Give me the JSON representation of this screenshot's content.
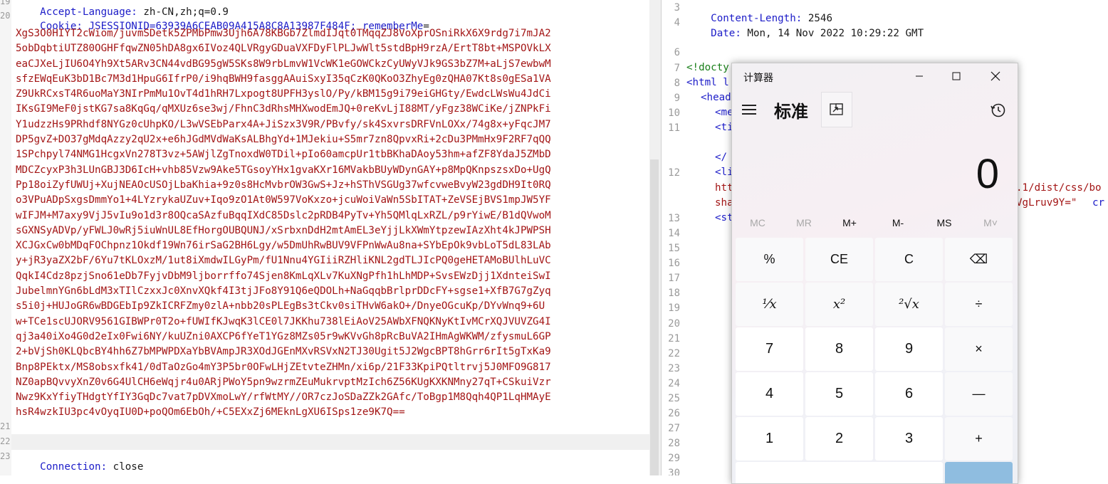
{
  "request_pane": {
    "lines": [
      {
        "n": "19",
        "key": "Accept-Language:",
        "value": " zh-CN,zh;q=0.9"
      },
      {
        "n": "20",
        "key": "Cookie:",
        "value": " JSESSIONID=63939A6CEAB09A415A8C8A13987F484F;",
        "key2": "rememberMe",
        "value2": "="
      }
    ],
    "cookie_value_lines": [
      "XgS3O0HIYT2cWiom/juvmSDetk5ZPMbPmw3Ujh6A78KBGb7ZlmdIJqt0TMqqZJ8VoXprOSniRkX6X9rdg7i7mJA2",
      "5obDqbtiUTZ80OGHFfqwZN05hDA8gx6IVoz4QLVRgyGDuaVXFDyFlPLJwWlt5stdBpH9rzA/ErtT8bt+MSPOVkLX",
      "eaCJXeLjIU6O4Yh9Xt5ARv3CN44vdBG95gW5SKs8W9rbLmvW1VcWK1eGOWCkzCyUWyVJk9GS3bZ7M+aLjS7ewbwM",
      "sfzEWqEuK3bD1Bc7M3d1HpuG6IfrP0/i9hqBWH9fasggAAuiSxyI35qCzK0QKoO3ZhyEg0zQHA07Kt8s0gESa1VA",
      "Z9UkRCxsT4R6uoMaY3NIrPmMu1OvT4d1hRH7Lxpogt8UPFH3yslO/Py/kBM15g9i79eiGHGty/EwdcLWsWu4JdCi",
      "IKsGI9MeF0jstKG7sa8KqGq/qMXUz6se3wj/FhnC3dRhsMHXwodEmJQ+0reKvLjI88MT/yFgz38WCiKe/jZNPkFi",
      "Y1udzzHs9PRhdf8NYGz0cUhpKO/L3wVSEbParx4A+JiSzx3V9R/PBvfy/sk4SxvrsDRFVnLOXx/74g8x+yFqcJM7",
      "DP5gvZ+DO37gMdqAzzy2qU2x+e6hJGdMVdWaKsALBhgYd+1MJekiu+S5mr7zn8QpvxRi+2cDu3PMmHx9F2RF7qQQ",
      "1SPchpyl74NMG1HcgxVn278T3vz+5AWjlZgTnoxdW0TDil+pIo60amcpUr1tbBKhaDAoy53hm+afZF8YdaJ5ZMbD",
      "MDCZcyxP3h3LUnGBJ3D6IcH+vhb85Vzw9Ake5TGsoyYHx1gvaKXr16MVakbBUyWDynGAY+p8MpQKnpszsxDo+UgQ",
      "Pp18oiZyfUWUj+XujNEAOcUSOjLbaKhia+9z0s8HcMvbrOW3GwS+Jz+hSThVSGUg37wfcvweBvyW23gdDH9It0RQ",
      "o3VPuADpSxgsDmmYo1+4LYzrykaUZuv+Iqo9zO1At0W597VoKxzo+jcuWoiVaWn5SbITAT+ZeVSEjBVS1mpJW5YF",
      "wIFJM+M7axy9VjJ5vIu9o1d3r8OQcaSAzfuBqqIXdC85Dslc2pRDB4PyTv+Yh5QMlqLxRZL/p9rYiwE/B1dQVwoM",
      "sGXNSyADVp/yFWLJ0wRj5iuWnUL8EfHorgOUBQUNJ/xSrbxnDdH2mtAmEL3eYjjLkXWmYtpzewIAzXht4kJPWPSH",
      "XCJGxCw0bMDqFOChpnz1Okdf19Wn76irSaG2BH6Lgy/w5DmUhRwBUV9VFPnWwAu8na+SYbEpOk9vbLoT5dL83LAb",
      "y+jR3yaZX2bF/6Yu7tKLOxzM/1ut8iXmdwILGyPm/fU1Nnu4YGIiiRZHliKNL2gdTLJIcPQ0geHETAMoBUlhLuVC",
      "QqkI4Cdz8pzjSno61eDb7FyjvDbM9ljborrffo74Sjen8KmLqXLv7KuXNgPfh1hLhMDP+SvsEWzDjj1XdnteiSwI",
      "JubelmnYGn6bLdM3xTIlCzxxJc0XnvXQkf4I3tjJFo8Y91Q6eQDOLh+NaGqqbBrlprDDcFY+sgse1+XfB7G7gZyq",
      "s5i0j+HUJoGR6wBDGEbIp9ZkICRFZmy0zlA+nbb20sPLEgBs3tCkv0siTHvW6akO+/DnyeOGcuKp/DYvWnq9+6U",
      "w+TCe1scUJORV9561GIBWPr0T2o+fUWIfKJwqK3lCE0l7JKKhu738lEiAoV25AWbXFNQKNyKtIvMCrXQJVUVZG4I",
      "qj3a40iXo4G0d2eIx0Fwi6NY/kuUZni0AXCP6fYeT1YGz8MZs05r9wKVvGh8pRcBuVA2IHmAgWKWM/zfysmuL6GP",
      "2+bVjSh0KLQbcBY4hh6Z7bMPWPDXaYbBVAmpJR3XOdJGEnMXvRSVxN2TJ30Ugit5J2WgcBPT8hGrr6rIt5gTxKa9",
      "Bnp8PEktx/MS8obsxfk41/0dTaOzGo4mY3P5br0OFwLHjZEtvteZHMn/xi6p/21F33KpiPQtltrvj5J0MFO9G817",
      "NZ0apBQvvyXnZ0v6G4UlCH6eWqjr4u0ARjPWoY5pn9wzrmZEuMukrvptMzIch6Z56KUgKXKNMny27qT+CSkuiVzr",
      "Nwz9KxYfiyTHdgtYfIY3GqDc7vat7pDVXmoLwY/rfWtMY//OR7czJoSDaZZk2GAfc/ToBgp1M8Qqh4QP1LqHMAyE",
      "hsR4wzkIU3pc4vOyqIU0D+poQOm6EbOh/+C5EXxZj6MEknLgXU6ISps1ze9K7Q=="
    ],
    "after_lines": [
      {
        "n": "21",
        "text": ""
      },
      {
        "n": "22",
        "text": ""
      },
      {
        "n": "23",
        "key": "Connection:",
        "value": " close"
      }
    ]
  },
  "response_pane": {
    "line_numbers": [
      "3",
      "4",
      "5",
      "6",
      "7",
      "8",
      "9",
      "10",
      "11",
      "",
      "12",
      "",
      "",
      "13",
      "14",
      "15",
      "16",
      "17",
      "18",
      "19",
      "20",
      "21",
      "22",
      "23",
      "24",
      "25",
      "26",
      "27",
      "28",
      "29",
      "30"
    ],
    "content_length_key": "Content-Length:",
    "content_length_value": " 2546",
    "date_key": "Date:",
    "date_value": " Mon, 14 Nov 2022 10:29:22 GMT",
    "doctype_fragment": "<!docty",
    "html_fragment": "<html l",
    "head_fragment": "<head",
    "me_fragment": "<me",
    "ti_fragment": "<ti",
    "title_close_fragment": "</",
    "link_fragment": "<li",
    "ht_fragment": "htt",
    "sha_fragment": "sha",
    "st_fragment": "<st",
    "css_tail": ".1/dist/css/bo",
    "integrity_tail": "VgLruv9Y=\"",
    "cr_tail": "cr"
  },
  "calculator": {
    "title": "计算器",
    "mode": "标准",
    "display": "0",
    "memory": [
      {
        "label": "MC",
        "enabled": false
      },
      {
        "label": "MR",
        "enabled": false
      },
      {
        "label": "M+",
        "enabled": true
      },
      {
        "label": "M-",
        "enabled": true
      },
      {
        "label": "MS",
        "enabled": true
      },
      {
        "label": "M˅",
        "enabled": false
      }
    ],
    "rows": [
      [
        "%",
        "CE",
        "C",
        "⌫"
      ],
      [
        "¹⁄x",
        "x²",
        "²√x",
        "÷"
      ],
      [
        "7",
        "8",
        "9",
        "×"
      ],
      [
        "4",
        "5",
        "6",
        "—"
      ],
      [
        "1",
        "2",
        "3",
        "+"
      ]
    ]
  }
}
